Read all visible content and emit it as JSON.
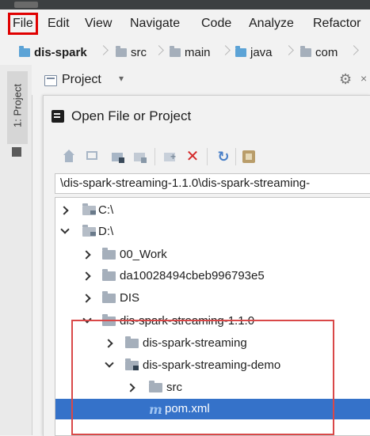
{
  "menu": {
    "items": [
      {
        "label": "File",
        "highlighted": true
      },
      {
        "label": "Edit"
      },
      {
        "label": "View"
      },
      {
        "label": "Navigate"
      },
      {
        "label": "Code"
      },
      {
        "label": "Analyze"
      },
      {
        "label": "Refactor"
      }
    ]
  },
  "breadcrumb": {
    "items": [
      "dis-spark",
      "src",
      "main",
      "java",
      "com"
    ]
  },
  "sidebar": {
    "tab_label": "1: Project"
  },
  "project_panel": {
    "title": "Project",
    "caret": "▾",
    "gear": "⚙",
    "close": "×"
  },
  "dialog": {
    "title": "Open File or Project",
    "toolbar": {
      "buttons": [
        "home-icon",
        "desktop-icon",
        "project-dir-icon",
        "module-dir-icon",
        "new-folder-icon",
        "delete-icon",
        "refresh-icon",
        "show-hidden-icon"
      ],
      "delete_glyph": "✕",
      "refresh_glyph": "↻"
    },
    "path_value": "\\dis-spark-streaming-1.1.0\\dis-spark-streaming-",
    "tree": [
      {
        "label": "C:\\",
        "state": "collapsed",
        "icon": "drive"
      },
      {
        "label": "D:\\",
        "state": "expanded",
        "icon": "drive"
      },
      {
        "label": "00_Work",
        "state": "collapsed",
        "icon": "folder"
      },
      {
        "label": "da10028494cbeb996793e5",
        "state": "collapsed",
        "icon": "folder"
      },
      {
        "label": "DIS",
        "state": "collapsed",
        "icon": "folder"
      },
      {
        "label": "dis-spark-streaming-1.1.0",
        "state": "expanded",
        "icon": "folder"
      },
      {
        "label": "dis-spark-streaming",
        "state": "collapsed",
        "icon": "folder"
      },
      {
        "label": "dis-spark-streaming-demo",
        "state": "expanded",
        "icon": "module"
      },
      {
        "label": "src",
        "state": "collapsed",
        "icon": "folder"
      },
      {
        "label": "pom.xml",
        "state": "leaf",
        "icon": "maven",
        "selected": true
      }
    ]
  },
  "colors": {
    "highlight_red": "#e00000",
    "annotation_red": "#d94848",
    "selection_blue": "#3572c9"
  }
}
